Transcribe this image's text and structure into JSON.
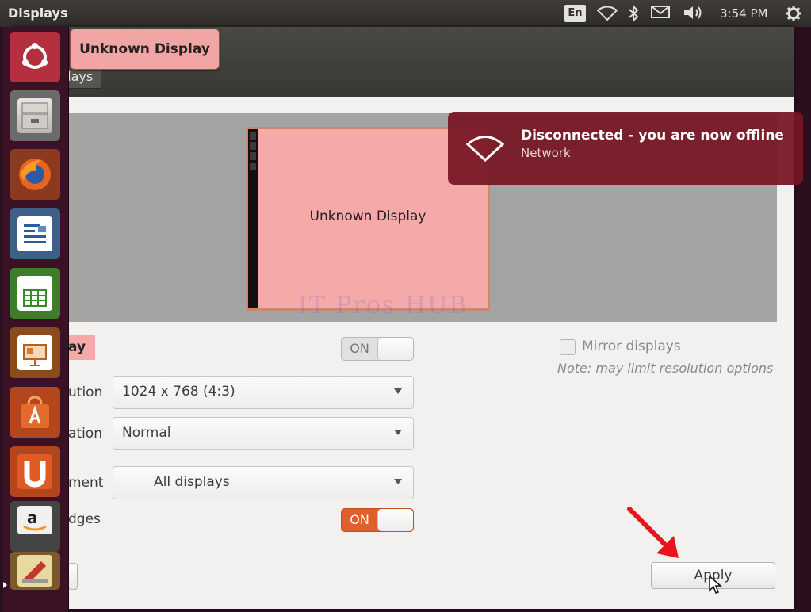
{
  "topbar": {
    "window_title": "Displays",
    "keyboard_lang": "En",
    "clock": "3:54 PM",
    "icons": [
      "wifi-icon",
      "bluetooth-icon",
      "mail-icon",
      "volume-icon",
      "gear-icon"
    ]
  },
  "window": {
    "breadcrumb": "plays",
    "monitor_label": "Unknown Display",
    "watermark": "IT Pros HUB",
    "display_name": "ay",
    "display_switch": "ON",
    "resolution_label": "ution",
    "resolution_value": "1024 x 768 (4:3)",
    "rotation_label": "ation",
    "rotation_value": "Normal",
    "launcher_placement_label": "ment",
    "launcher_placement_value": "All displays",
    "sticky_edges_label": "dges",
    "sticky_edges_switch": "ON",
    "mirror_label": "Mirror displays",
    "mirror_note": "Note: may limit resolution options",
    "apply_button": "Apply"
  },
  "tooltip": {
    "text": "Unknown Display"
  },
  "notification": {
    "title": "Disconnected - you are now offline",
    "subtitle": "Network",
    "icon": "wifi-icon"
  },
  "launcher": {
    "items": [
      {
        "name": "dash-home",
        "icon": "ubuntu-icon"
      },
      {
        "name": "files",
        "icon": "file-cabinet-icon"
      },
      {
        "name": "firefox",
        "icon": "firefox-icon"
      },
      {
        "name": "libreoffice-writer",
        "icon": "writer-icon"
      },
      {
        "name": "libreoffice-calc",
        "icon": "calc-icon"
      },
      {
        "name": "libreoffice-impress",
        "icon": "impress-icon"
      },
      {
        "name": "software-center",
        "icon": "shopping-bag-icon"
      },
      {
        "name": "ubuntu-one",
        "icon": "ubuntu-one-icon"
      },
      {
        "name": "amazon",
        "icon": "amazon-icon"
      },
      {
        "name": "system-settings",
        "icon": "settings-icon"
      }
    ]
  },
  "colors": {
    "accent_orange": "#e0602c",
    "notification_bg": "#761624",
    "highlight_pink": "#f5a9a9",
    "annotation_arrow": "#e8141c"
  }
}
